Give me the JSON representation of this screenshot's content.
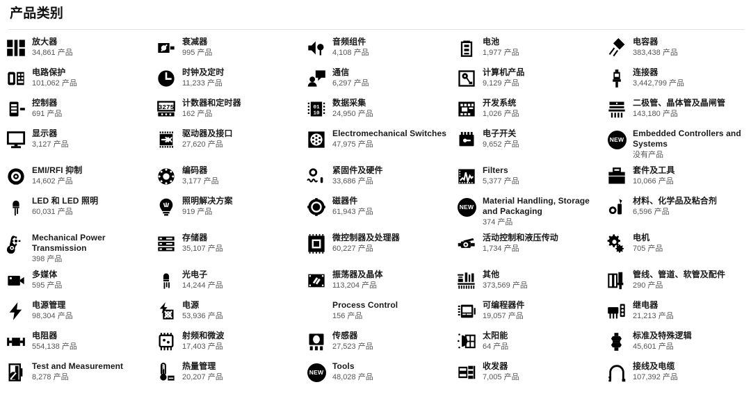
{
  "header": {
    "title": "产品类别"
  },
  "unit": "产品",
  "categories": [
    {
      "label": "放大器",
      "count": "34,861 产品",
      "icon": "amplifier-icon"
    },
    {
      "label": "衰减器",
      "count": "995 产品",
      "icon": "attenuator-icon"
    },
    {
      "label": "音频组件",
      "count": "4,108 产品",
      "icon": "audio-products-icon"
    },
    {
      "label": "电池",
      "count": "1,977 产品",
      "icon": "battery-icon"
    },
    {
      "label": "电容器",
      "count": "383,438 产品",
      "icon": "capacitor-icon"
    },
    {
      "label": "电路保护",
      "count": "101,062 产品",
      "icon": "circuit-protection-icon"
    },
    {
      "label": "时钟及定时",
      "count": "11,233 产品",
      "icon": "clock-timing-icon"
    },
    {
      "label": "通信",
      "count": "6,297 产品",
      "icon": "communication-icon"
    },
    {
      "label": "计算机产品",
      "count": "9,129 产品",
      "icon": "computer-products-icon"
    },
    {
      "label": "连接器",
      "count": "3,442,799 产品",
      "icon": "connector-icon"
    },
    {
      "label": "控制器",
      "count": "691 产品",
      "icon": "controller-icon"
    },
    {
      "label": "计数器和定时器",
      "count": "162 产品",
      "icon": "counter-timer-icon"
    },
    {
      "label": "数据采集",
      "count": "24,950 产品",
      "icon": "data-acquisition-icon"
    },
    {
      "label": "开发系统",
      "count": "1,026 产品",
      "icon": "development-system-icon"
    },
    {
      "label": "二极管、晶体管及晶闸管",
      "count": "143,180 产品",
      "icon": "diode-transistor-icon"
    },
    {
      "label": "显示器",
      "count": "3,127 产品",
      "icon": "display-icon"
    },
    {
      "label": "驱动器及接口",
      "count": "27,620 产品",
      "icon": "driver-interface-icon"
    },
    {
      "label": "Electromechanical Switches",
      "count": "47,975 产品",
      "icon": "electromechanical-switch-icon"
    },
    {
      "label": "电子开关",
      "count": "9,652 产品",
      "icon": "electronic-switch-icon"
    },
    {
      "label": "Embedded Controllers and Systems",
      "count": "没有产品",
      "icon": "new-badge-icon",
      "badge": "NEW"
    },
    {
      "label": "EMI/RFI 抑制",
      "count": "14,602 产品",
      "icon": "emi-rfi-icon"
    },
    {
      "label": "编码器",
      "count": "3,177 产品",
      "icon": "encoder-icon"
    },
    {
      "label": "紧固件及硬件",
      "count": "33,686 产品",
      "icon": "fastener-hardware-icon"
    },
    {
      "label": "Filters",
      "count": "5,377 产品",
      "icon": "filter-icon"
    },
    {
      "label": "套件及工具",
      "count": "10,066 产品",
      "icon": "kits-tools-icon"
    },
    {
      "label": "LED 和 LED 照明",
      "count": "60,031 产品",
      "icon": "led-icon"
    },
    {
      "label": "照明解决方案",
      "count": "919 产品",
      "icon": "lighting-solution-icon"
    },
    {
      "label": "磁器件",
      "count": "61,943 产品",
      "icon": "magnetics-icon"
    },
    {
      "label": "Material Handling, Storage and Packaging",
      "count": "374 产品",
      "icon": "new-badge-icon",
      "badge": "NEW"
    },
    {
      "label": "材料、化学品及粘合剂",
      "count": "6,596 产品",
      "icon": "materials-chemicals-icon"
    },
    {
      "label": "Mechanical Power Transmission",
      "count": "398 产品",
      "icon": "mechanical-power-icon"
    },
    {
      "label": "存储器",
      "count": "35,107 产品",
      "icon": "memory-icon"
    },
    {
      "label": "微控制器及处理器",
      "count": "60,227 产品",
      "icon": "microcontroller-icon"
    },
    {
      "label": "活动控制和液压传动",
      "count": "1,734 产品",
      "icon": "motion-control-icon"
    },
    {
      "label": "电机",
      "count": "705 产品",
      "icon": "motor-icon"
    },
    {
      "label": "多媒体",
      "count": "595 产品",
      "icon": "multimedia-icon"
    },
    {
      "label": "光电子",
      "count": "14,244 产品",
      "icon": "optoelectronics-icon"
    },
    {
      "label": "振荡器及晶体",
      "count": "113,204 产品",
      "icon": "oscillator-crystal-icon"
    },
    {
      "label": "其他",
      "count": "373,569 产品",
      "icon": "other-icon"
    },
    {
      "label": "管线、管道、软管及配件",
      "count": "290 产品",
      "icon": "pipe-tube-hose-icon"
    },
    {
      "label": "电源管理",
      "count": "98,304 产品",
      "icon": "power-management-icon"
    },
    {
      "label": "电源",
      "count": "53,936 产品",
      "icon": "power-supply-icon"
    },
    {
      "label": "Process Control",
      "count": "156 产品",
      "icon": "none"
    },
    {
      "label": "可编程器件",
      "count": "19,057 产品",
      "icon": "programmable-device-icon"
    },
    {
      "label": "继电器",
      "count": "21,213 产品",
      "icon": "relay-icon"
    },
    {
      "label": "电阻器",
      "count": "554,138 产品",
      "icon": "resistor-icon"
    },
    {
      "label": "射频和微波",
      "count": "17,403 产品",
      "icon": "rf-microwave-icon"
    },
    {
      "label": "传感器",
      "count": "27,523 产品",
      "icon": "sensor-icon"
    },
    {
      "label": "太阳能",
      "count": "64 产品",
      "icon": "solar-icon"
    },
    {
      "label": "标准及特殊逻辑",
      "count": "45,601 产品",
      "icon": "standard-logic-icon"
    },
    {
      "label": "Test and Measurement",
      "count": "8,278 产品",
      "icon": "test-measurement-icon"
    },
    {
      "label": "热量管理",
      "count": "20,207 产品",
      "icon": "thermal-management-icon"
    },
    {
      "label": "Tools",
      "count": "48,028 产品",
      "icon": "new-badge-icon",
      "badge": "NEW"
    },
    {
      "label": "收发器",
      "count": "7,005 产品",
      "icon": "transceiver-icon"
    },
    {
      "label": "接线及电缆",
      "count": "107,392 产品",
      "icon": "wire-cable-icon"
    }
  ]
}
